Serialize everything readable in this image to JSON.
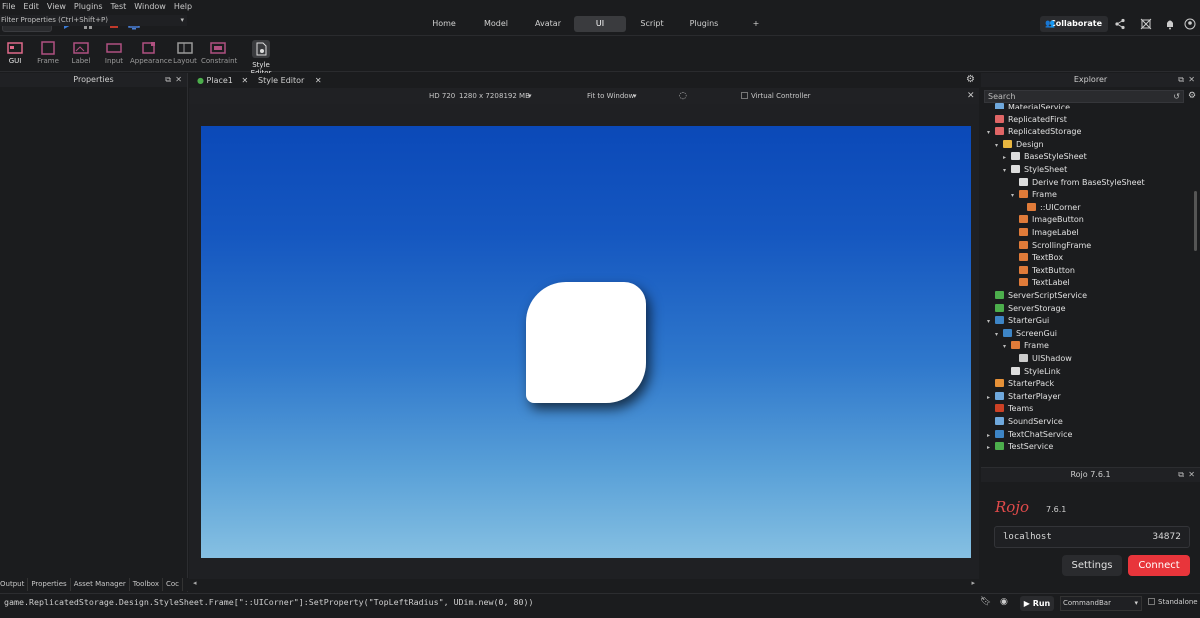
{
  "menu": [
    "File",
    "Edit",
    "View",
    "Plugins",
    "Test",
    "Window",
    "Help"
  ],
  "mode_select": "Test",
  "tabs": [
    "Home",
    "Model",
    "Avatar",
    "UI",
    "Script",
    "Plugins",
    "+"
  ],
  "active_tab": "UI",
  "collaborate_label": "Collaborate",
  "ribbon": [
    "GUI",
    "Frame",
    "Label",
    "Input",
    "Appearance",
    "Layout",
    "Constraint",
    "Style Editor"
  ],
  "properties": {
    "title": "Properties",
    "filter_placeholder": "Filter Properties (Ctrl+Shift+P)"
  },
  "bottom_tabs": [
    "Output",
    "Properties",
    "Asset Manager",
    "Toolbox",
    "Coc"
  ],
  "doc_tabs": [
    "Place1",
    "Style Editor"
  ],
  "view_bar": {
    "device": "HD 720",
    "resolution": "1280 x 720",
    "memory": "8192 MB",
    "fit": "Fit to Window",
    "virtual_controller": "Virtual Controller"
  },
  "explorer": {
    "title": "Explorer",
    "search_placeholder": "Search",
    "items": [
      {
        "label": "MaterialService",
        "depth": 1,
        "arrow": "",
        "color": "#6fa8dc"
      },
      {
        "label": "ReplicatedFirst",
        "depth": 1,
        "arrow": "",
        "color": "#e06666"
      },
      {
        "label": "ReplicatedStorage",
        "depth": 1,
        "arrow": "▾",
        "color": "#e06666"
      },
      {
        "label": "Design",
        "depth": 2,
        "arrow": "▾",
        "color": "#e8b640"
      },
      {
        "label": "BaseStyleSheet",
        "depth": 3,
        "arrow": "▸",
        "color": "#dddddd"
      },
      {
        "label": "StyleSheet",
        "depth": 3,
        "arrow": "▾",
        "color": "#dddddd"
      },
      {
        "label": "Derive from BaseStyleSheet",
        "depth": 4,
        "arrow": "",
        "color": "#dddddd"
      },
      {
        "label": "Frame",
        "depth": 4,
        "arrow": "▾",
        "color": "#e07b39"
      },
      {
        "label": "::UICorner",
        "depth": 5,
        "arrow": "",
        "color": "#e07b39"
      },
      {
        "label": "ImageButton",
        "depth": 4,
        "arrow": "",
        "color": "#e07b39"
      },
      {
        "label": "ImageLabel",
        "depth": 4,
        "arrow": "",
        "color": "#e07b39"
      },
      {
        "label": "ScrollingFrame",
        "depth": 4,
        "arrow": "",
        "color": "#e07b39"
      },
      {
        "label": "TextBox",
        "depth": 4,
        "arrow": "",
        "color": "#e07b39"
      },
      {
        "label": "TextButton",
        "depth": 4,
        "arrow": "",
        "color": "#e07b39"
      },
      {
        "label": "TextLabel",
        "depth": 4,
        "arrow": "",
        "color": "#e07b39"
      },
      {
        "label": "ServerScriptService",
        "depth": 1,
        "arrow": "",
        "color": "#4cae4c"
      },
      {
        "label": "ServerStorage",
        "depth": 1,
        "arrow": "",
        "color": "#4cae4c"
      },
      {
        "label": "StarterGui",
        "depth": 1,
        "arrow": "▾",
        "color": "#3d85c6"
      },
      {
        "label": "ScreenGui",
        "depth": 2,
        "arrow": "▾",
        "color": "#3d85c6"
      },
      {
        "label": "Frame",
        "depth": 3,
        "arrow": "▾",
        "color": "#e07b39"
      },
      {
        "label": "UIShadow",
        "depth": 4,
        "arrow": "",
        "color": "#cccccc"
      },
      {
        "label": "StyleLink",
        "depth": 3,
        "arrow": "",
        "color": "#dddddd"
      },
      {
        "label": "StarterPack",
        "depth": 1,
        "arrow": "",
        "color": "#e69138"
      },
      {
        "label": "StarterPlayer",
        "depth": 1,
        "arrow": "▸",
        "color": "#6fa8dc"
      },
      {
        "label": "Teams",
        "depth": 1,
        "arrow": "",
        "color": "#cc4125"
      },
      {
        "label": "SoundService",
        "depth": 1,
        "arrow": "",
        "color": "#6fa8dc"
      },
      {
        "label": "TextChatService",
        "depth": 1,
        "arrow": "▸",
        "color": "#3d85c6"
      },
      {
        "label": "TestService",
        "depth": 1,
        "arrow": "▸",
        "color": "#4cae4c"
      }
    ]
  },
  "rojo": {
    "title": "Rojo 7.6.1",
    "logo": "Rojo",
    "version": "7.6.1",
    "host": "localhost",
    "port": "34872",
    "settings_label": "Settings",
    "connect_label": "Connect"
  },
  "command_bar": {
    "text": "game.ReplicatedStorage.Design.StyleSheet.Frame[\"::UICorner\"]:SetProperty(\"TopLeftRadius\", UDim.new(0, 80))",
    "run_label": "Run",
    "dropdown": "CommandBar",
    "standalone": "Standalone"
  },
  "colors": {
    "accent": "#e8353b",
    "canvas_top": "#0b49b8",
    "canvas_bottom": "#86c0e2"
  }
}
